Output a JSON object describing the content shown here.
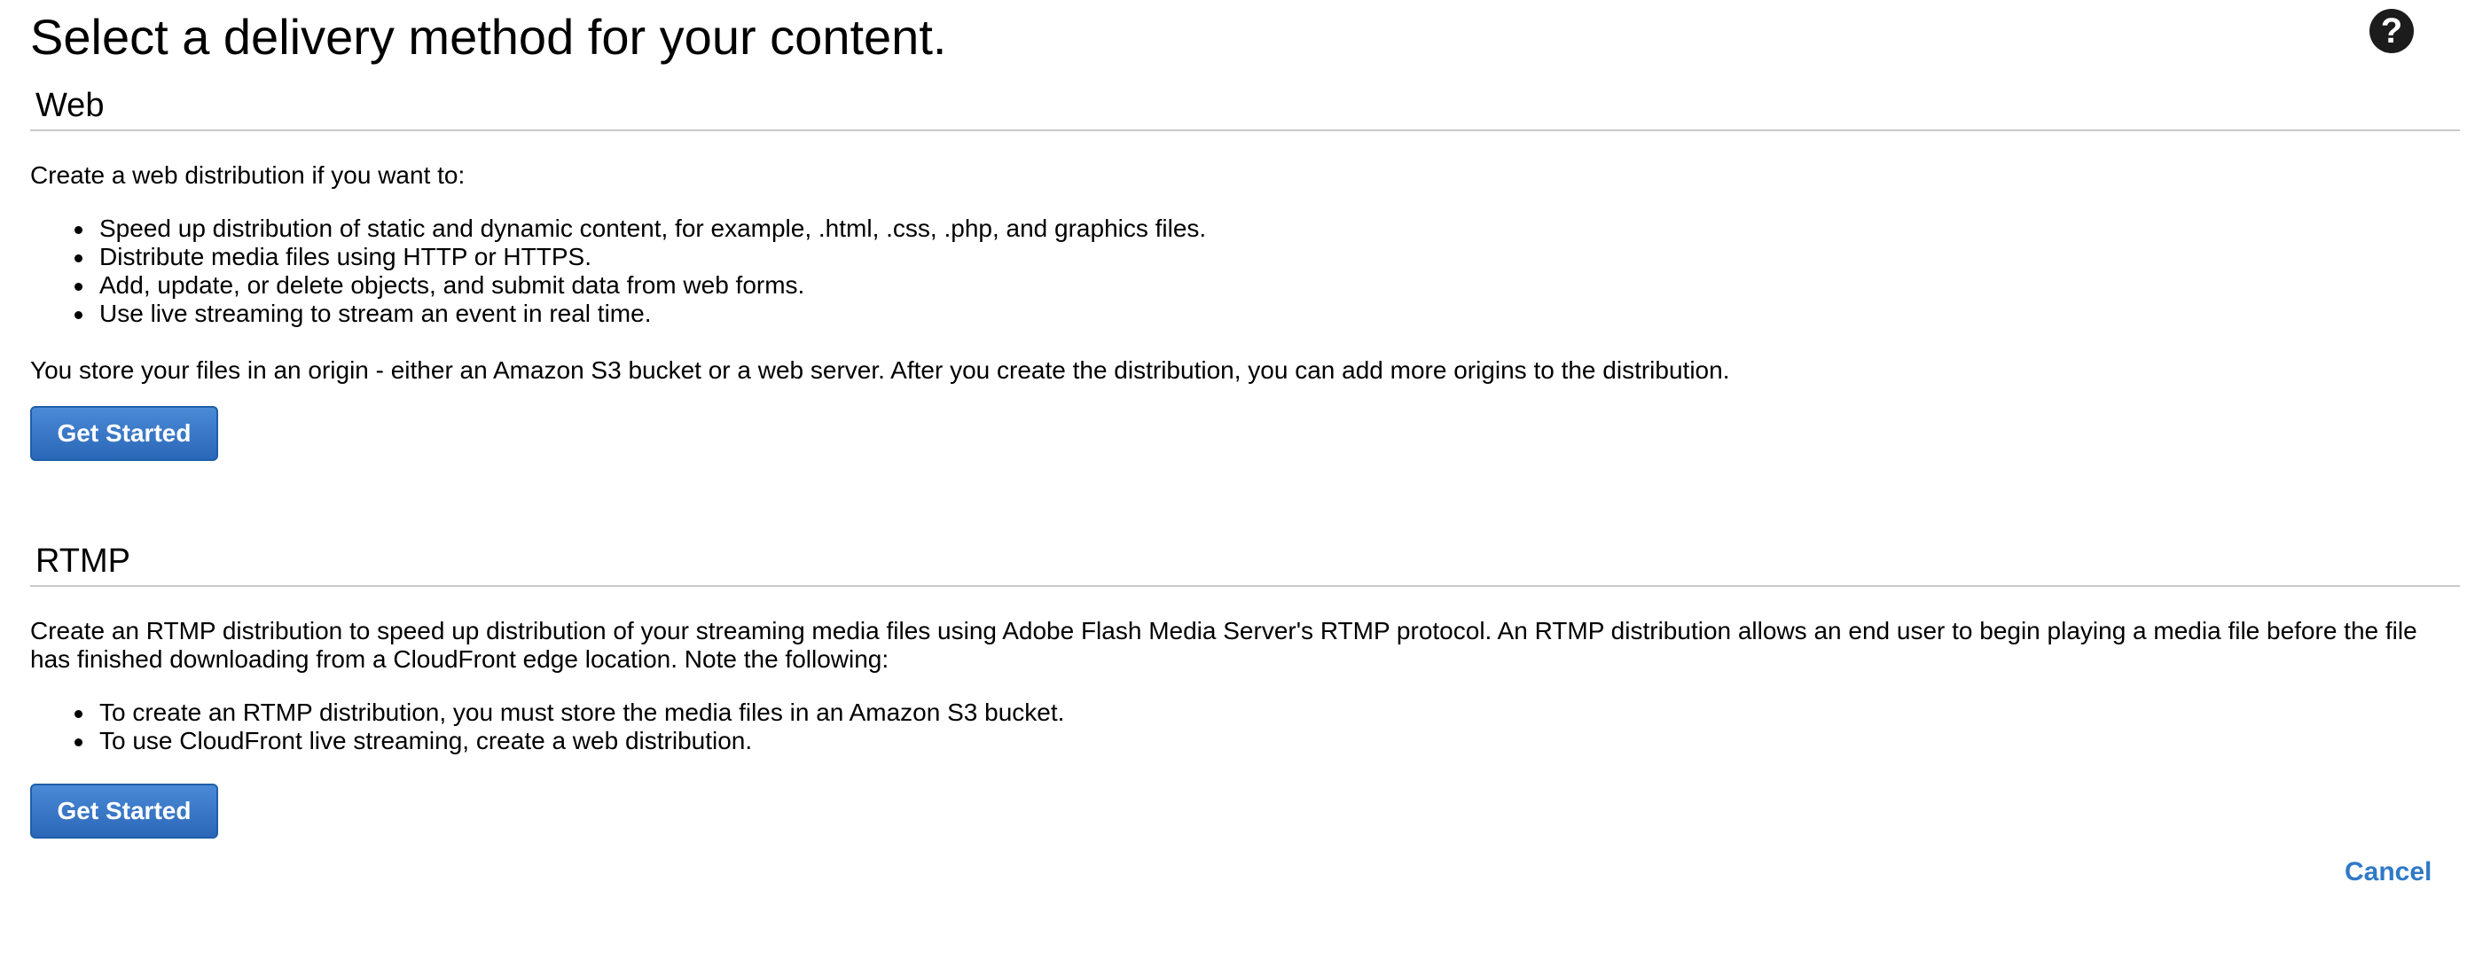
{
  "page": {
    "title": "Select a delivery method for your content.",
    "help_icon": "question-circle-icon",
    "help_glyph": "?"
  },
  "web": {
    "heading": "Web",
    "intro": "Create a web distribution if you want to:",
    "bullets": [
      "Speed up distribution of static and dynamic content, for example, .html, .css, .php, and graphics files.",
      "Distribute media files using HTTP or HTTPS.",
      "Add, update, or delete objects, and submit data from web forms.",
      "Use live streaming to stream an event in real time."
    ],
    "note": "You store your files in an origin - either an Amazon S3 bucket or a web server. After you create the distribution, you can add more origins to the distribution.",
    "button_label": "Get Started"
  },
  "rtmp": {
    "heading": "RTMP",
    "intro": "Create an RTMP distribution to speed up distribution of your streaming media files using Adobe Flash Media Server's RTMP protocol. An RTMP distribution allows an end user to begin playing a media file before the file has finished downloading from a CloudFront edge location. Note the following:",
    "bullets": [
      "To create an RTMP distribution, you must store the media files in an Amazon S3 bucket.",
      "To use CloudFront live streaming, create a web distribution."
    ],
    "button_label": "Get Started"
  },
  "footer": {
    "cancel_label": "Cancel"
  },
  "colors": {
    "button_blue": "#2b67b8",
    "link_blue": "#2f79c8",
    "rule_gray": "#c9c9c9"
  }
}
